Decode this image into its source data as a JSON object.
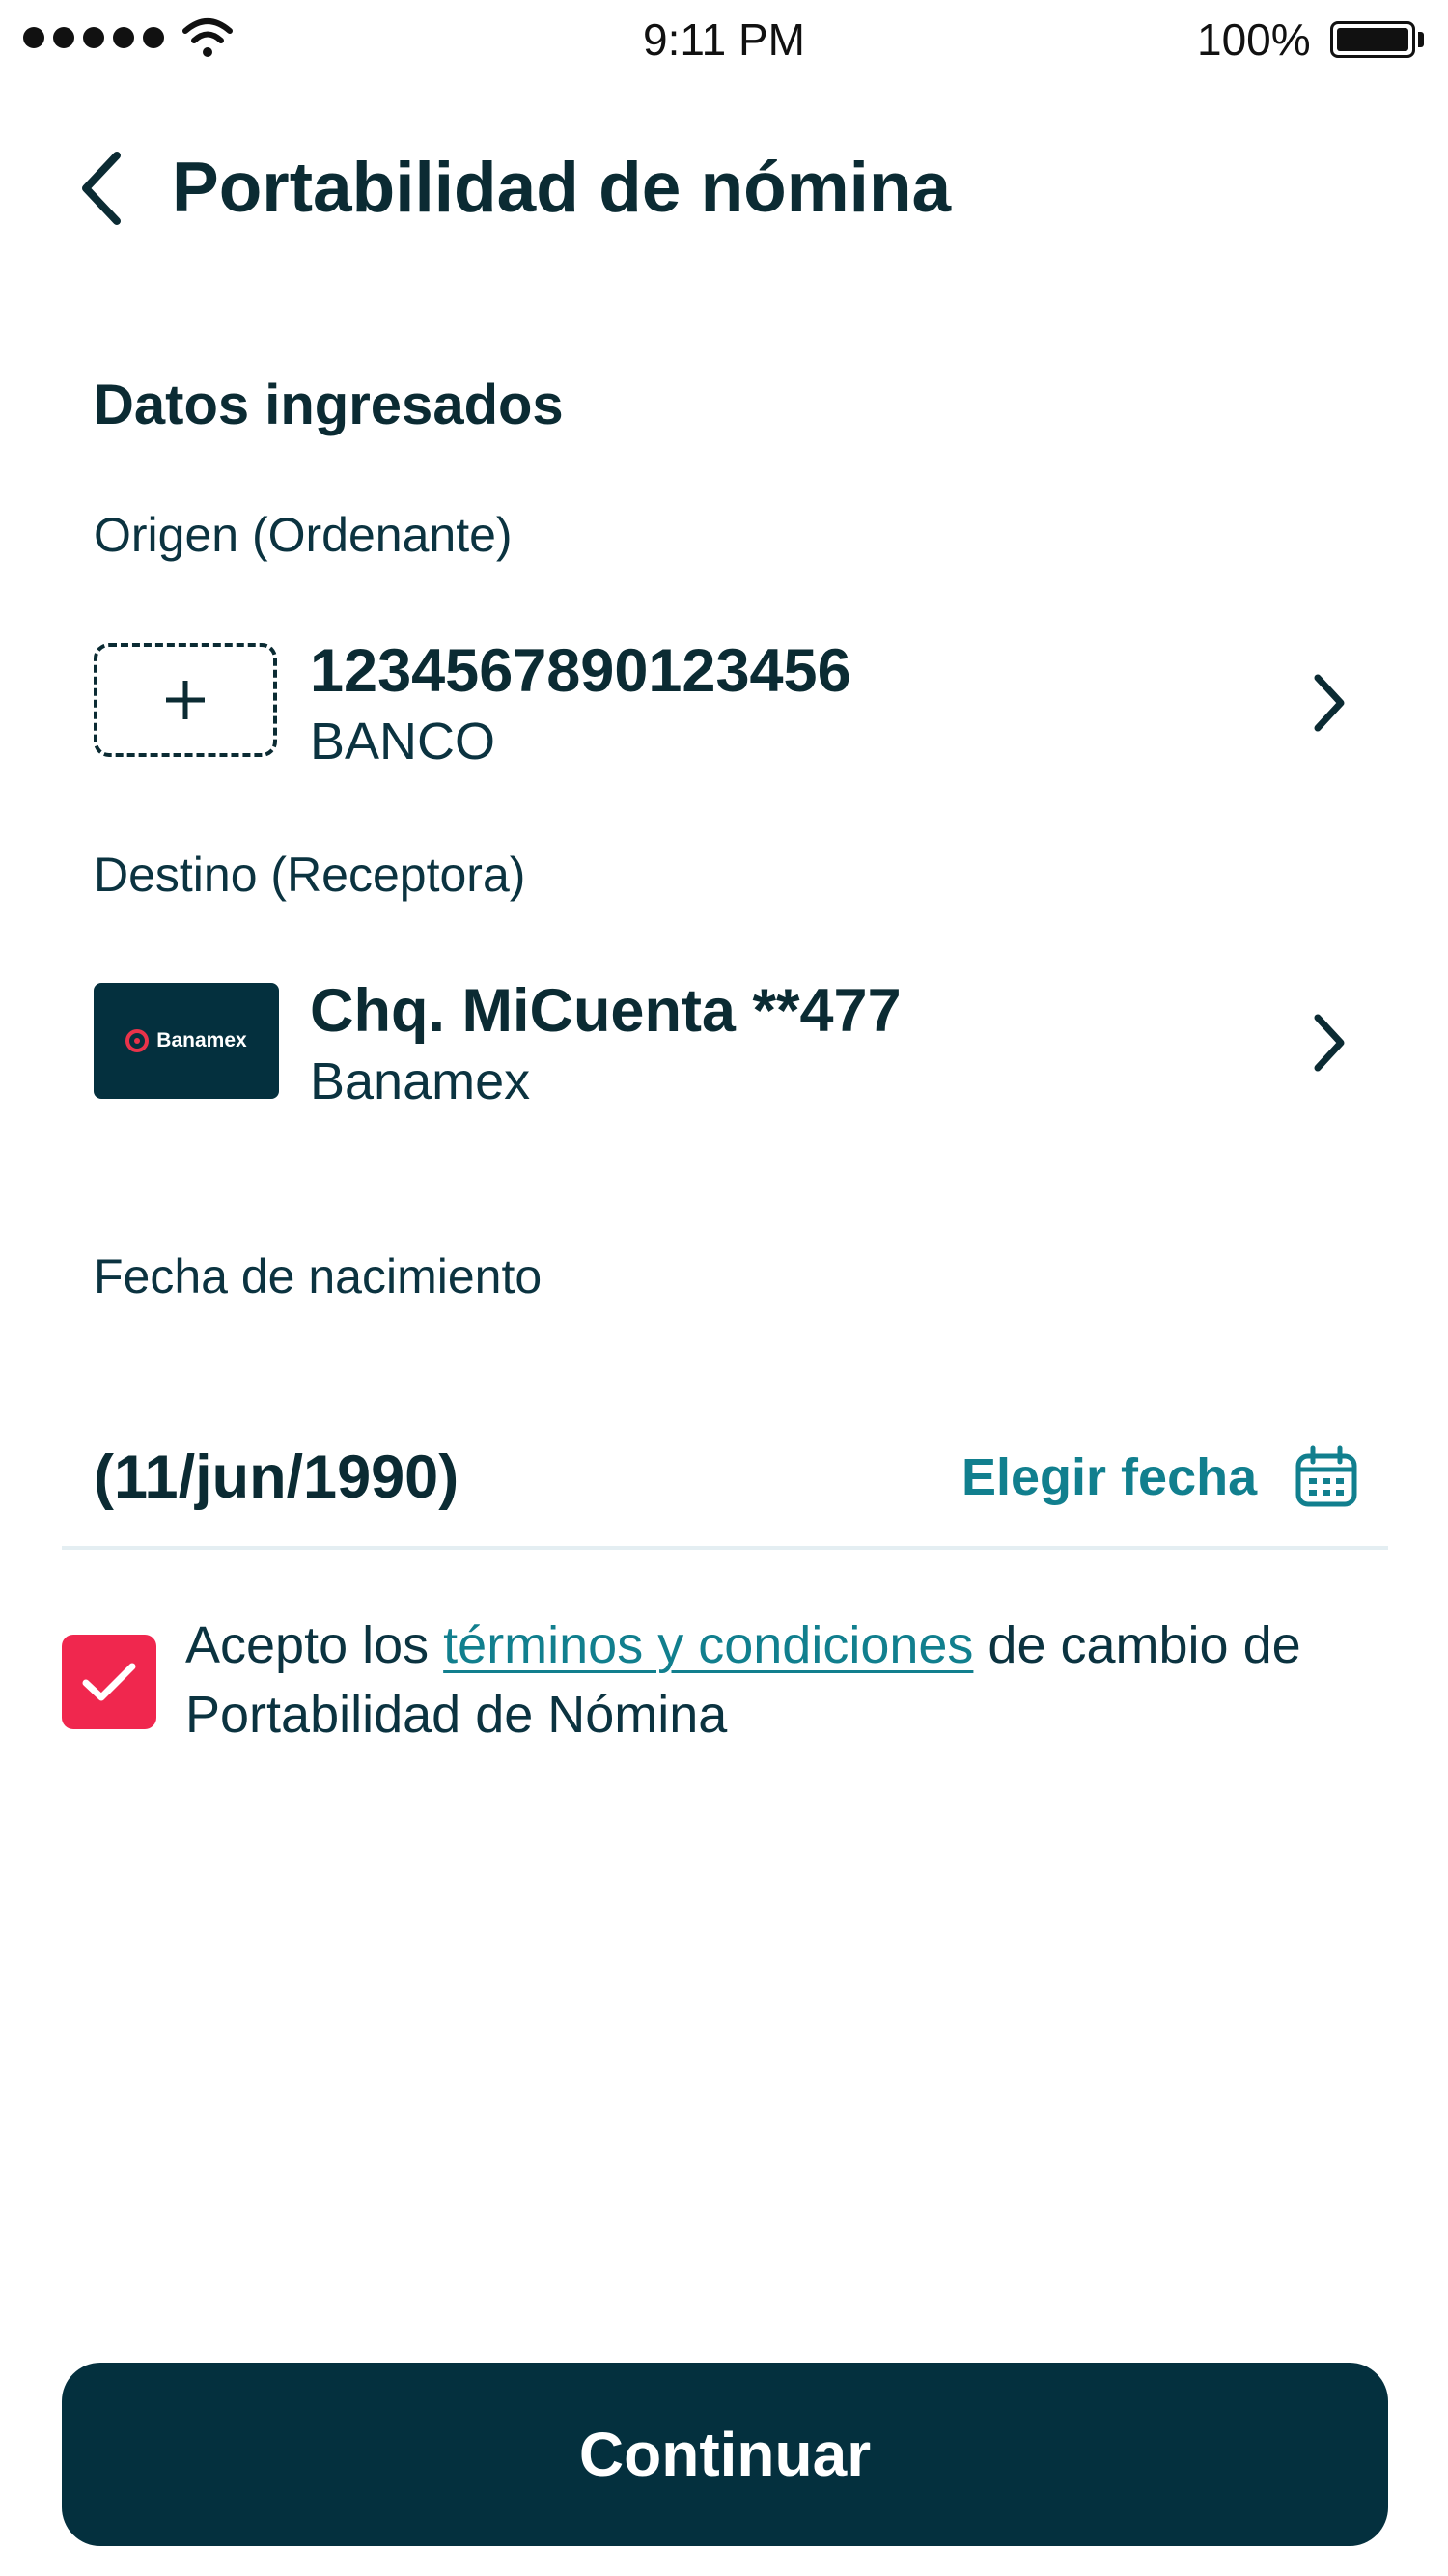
{
  "status_bar": {
    "time": "9:11 PM",
    "battery": "100%"
  },
  "header": {
    "title": "Portabilidad de nómina"
  },
  "section": {
    "title": "Datos ingresados"
  },
  "origin": {
    "label": "Origen (Ordenante)",
    "account": "1234567890123456",
    "bank": "BANCO"
  },
  "destination": {
    "label": "Destino (Receptora)",
    "account": "Chq. MiCuenta **477",
    "bank": "Banamex",
    "logo_text": "Banamex"
  },
  "birthdate": {
    "label": "Fecha de nacimiento",
    "value": "(11/jun/1990)",
    "choose_label": "Elegir fecha"
  },
  "terms": {
    "checked": true,
    "prefix": "Acepto los ",
    "link": "términos y condiciones",
    "suffix": " de cambio de Portabilidad de Nómina"
  },
  "actions": {
    "continue": "Continuar"
  },
  "colors": {
    "primary": "#04303e",
    "accent": "#117f8e",
    "checkbox": "#f0274e",
    "logo_mark": "#e8334a"
  },
  "icons": [
    "signal-icon",
    "wifi-icon",
    "battery-icon",
    "back-chevron-icon",
    "plus-icon",
    "chevron-right-icon",
    "banamex-logo-icon",
    "calendar-icon",
    "checkmark-icon"
  ]
}
